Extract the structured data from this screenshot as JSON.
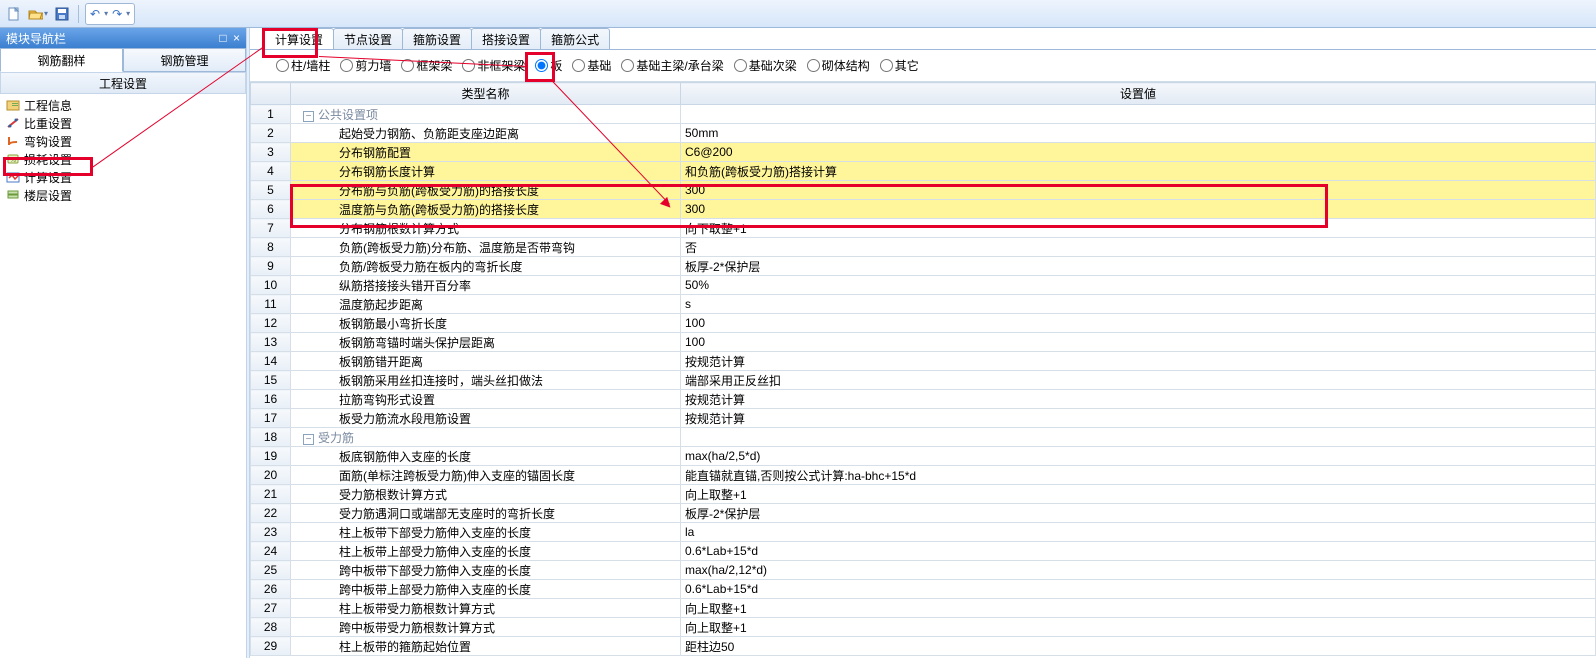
{
  "toolbar": {
    "new_tip": "新建",
    "open_tip": "打开",
    "save_tip": "保存"
  },
  "nav": {
    "title": "模块导航栏",
    "pin": "□",
    "close": "×",
    "tab_left": "钢筋翻样",
    "tab_right": "钢筋管理",
    "section": "工程设置"
  },
  "tree_items": [
    {
      "label": "工程信息"
    },
    {
      "label": "比重设置"
    },
    {
      "label": "弯钩设置"
    },
    {
      "label": "损耗设置"
    },
    {
      "label": "计算设置"
    },
    {
      "label": "楼层设置"
    }
  ],
  "page_tabs": [
    {
      "label": "计算设置",
      "active": true
    },
    {
      "label": "节点设置"
    },
    {
      "label": "箍筋设置"
    },
    {
      "label": "搭接设置"
    },
    {
      "label": "箍筋公式"
    }
  ],
  "radios": [
    {
      "label": "柱/墙柱"
    },
    {
      "label": "剪力墙"
    },
    {
      "label": "框架梁"
    },
    {
      "label": "非框架梁"
    },
    {
      "label": "板",
      "checked": true
    },
    {
      "label": "基础"
    },
    {
      "label": "基础主梁/承台梁"
    },
    {
      "label": "基础次梁"
    },
    {
      "label": "砌体结构"
    },
    {
      "label": "其它"
    }
  ],
  "grid": {
    "col_name": "类型名称",
    "col_value": "设置値"
  },
  "rows": [
    {
      "n": 1,
      "type": "group",
      "name": "公共设置项",
      "value": ""
    },
    {
      "n": 2,
      "name": "起始受力钢筋、负筋距支座边距离",
      "value": "50mm"
    },
    {
      "n": 3,
      "name": "分布钢筋配置",
      "value": "C6@200",
      "yellow": true
    },
    {
      "n": 4,
      "name": "分布钢筋长度计算",
      "value": "和负筋(跨板受力筋)搭接计算",
      "yellow": true,
      "cut": true
    },
    {
      "n": 5,
      "name": "分布筋与负筋(跨板受力筋)的搭接长度",
      "value": "300",
      "yellow": true
    },
    {
      "n": 6,
      "name": "温度筋与负筋(跨板受力筋)的搭接长度",
      "value": "300",
      "yellow": true
    },
    {
      "n": 7,
      "name": "分布钢筋根数计算方式",
      "value": "向下取整+1"
    },
    {
      "n": 8,
      "name": "负筋(跨板受力筋)分布筋、温度筋是否带弯钩",
      "value": "否"
    },
    {
      "n": 9,
      "name": "负筋/跨板受力筋在板内的弯折长度",
      "value": "板厚-2*保护层"
    },
    {
      "n": 10,
      "name": "纵筋搭接接头错开百分率",
      "value": "50%"
    },
    {
      "n": 11,
      "name": "温度筋起步距离",
      "value": "s"
    },
    {
      "n": 12,
      "name": "板钢筋最小弯折长度",
      "value": "100"
    },
    {
      "n": 13,
      "name": "板钢筋弯锚时端头保护层距离",
      "value": "100"
    },
    {
      "n": 14,
      "name": "板钢筋错开距离",
      "value": "按规范计算"
    },
    {
      "n": 15,
      "name": "板钢筋采用丝扣连接时，端头丝扣做法",
      "value": "端部采用正反丝扣"
    },
    {
      "n": 16,
      "name": "拉筋弯钩形式设置",
      "value": "按规范计算"
    },
    {
      "n": 17,
      "name": "板受力筋流水段甩筋设置",
      "value": "按规范计算"
    },
    {
      "n": 18,
      "type": "group",
      "name": "受力筋",
      "value": ""
    },
    {
      "n": 19,
      "name": "板底钢筋伸入支座的长度",
      "value": "max(ha/2,5*d)"
    },
    {
      "n": 20,
      "name": "面筋(单标注跨板受力筋)伸入支座的锚固长度",
      "value": "能直锚就直锚,否则按公式计算:ha-bhc+15*d"
    },
    {
      "n": 21,
      "name": "受力筋根数计算方式",
      "value": "向上取整+1"
    },
    {
      "n": 22,
      "name": "受力筋遇洞口或端部无支座时的弯折长度",
      "value": "板厚-2*保护层"
    },
    {
      "n": 23,
      "name": "柱上板带下部受力筋伸入支座的长度",
      "value": "la"
    },
    {
      "n": 24,
      "name": "柱上板带上部受力筋伸入支座的长度",
      "value": "0.6*Lab+15*d"
    },
    {
      "n": 25,
      "name": "跨中板带下部受力筋伸入支座的长度",
      "value": "max(ha/2,12*d)"
    },
    {
      "n": 26,
      "name": "跨中板带上部受力筋伸入支座的长度",
      "value": "0.6*Lab+15*d"
    },
    {
      "n": 27,
      "name": "柱上板带受力筋根数计算方式",
      "value": "向上取整+1"
    },
    {
      "n": 28,
      "name": "跨中板带受力筋根数计算方式",
      "value": "向上取整+1"
    },
    {
      "n": 29,
      "name": "柱上板带的箍筋起始位置",
      "value": "距柱边50"
    }
  ],
  "annotations": {
    "tree_highlight_index": 4,
    "highlight_rows": [
      5,
      6
    ]
  }
}
